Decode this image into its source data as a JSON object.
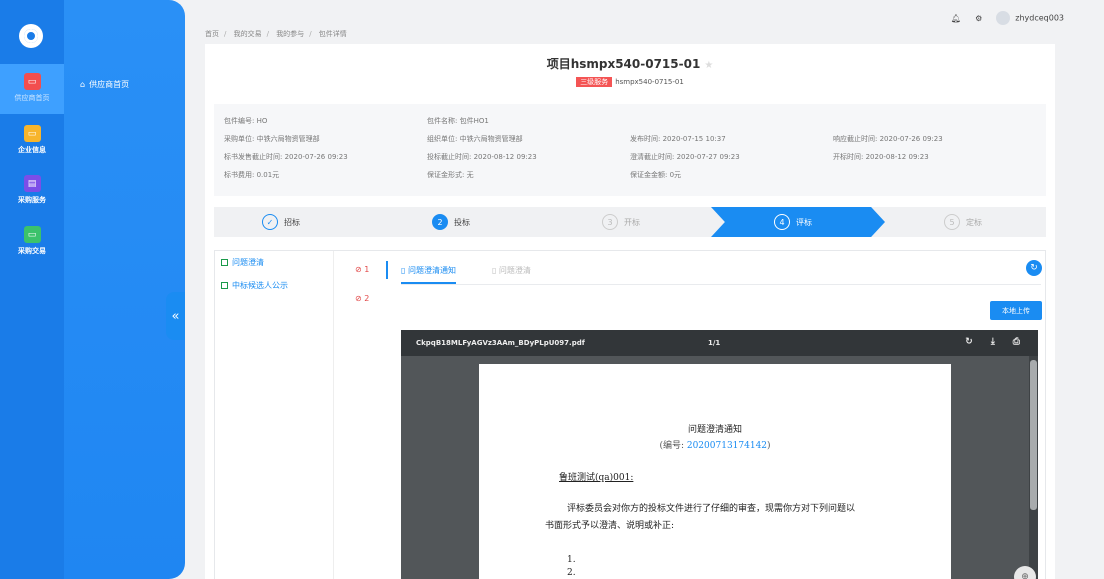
{
  "sidebar": {
    "rail": [
      {
        "label": "供应商首页",
        "color": "#f24e4e"
      },
      {
        "label": "企业信息",
        "color": "#f7b52c"
      },
      {
        "label": "采购服务",
        "color": "#7b4ee8"
      },
      {
        "label": "采购交易",
        "color": "#3bc26b"
      }
    ],
    "sub_item": "供应商首页"
  },
  "breadcrumb": [
    "首页",
    "我的交易",
    "我的参与",
    "包件详情"
  ],
  "topbar": {
    "username": "zhydceq003"
  },
  "project": {
    "title": "项目hsmpx540-0715-01",
    "tag": "三级服务",
    "code": "hsmpx540-0715-01"
  },
  "info": {
    "row1": [
      "包件编号: HO",
      "包件名称: 包件HO1"
    ],
    "row2": [
      "采购单位: 中铁六局物资管理部",
      "组织单位: 中铁六局物资管理部",
      "发布时间: 2020-07-15 10:37",
      "响应截止时间: 2020-07-26 09:23"
    ],
    "row3": [
      "标书发售截止时间: 2020-07-26 09:23",
      "投标截止时间: 2020-08-12 09:23",
      "澄清截止时间: 2020-07-27 09:23",
      "开标时间: 2020-08-12 09:23"
    ],
    "row4": [
      "标书费用: 0.01元",
      "保证金形式: 无",
      "保证金金额: 0元"
    ]
  },
  "steps": [
    {
      "num": "✓",
      "label": "招标"
    },
    {
      "num": "2",
      "label": "投标"
    },
    {
      "num": "3",
      "label": "开标"
    },
    {
      "num": "4",
      "label": "评标"
    },
    {
      "num": "5",
      "label": "定标"
    }
  ],
  "tree": [
    "问题澄清",
    "中标候选人公示"
  ],
  "badges": [
    "1",
    "2"
  ],
  "tabs": {
    "active": "问题澄清通知",
    "inactive": "问题澄清"
  },
  "upload_label": "本地上传",
  "pdf": {
    "filename": "CkpqB18MLFyAGVz3AAm_BDyPLpU097.pdf",
    "page": "1/1",
    "doc_title": "问题澄清通知",
    "doc_no_prefix": "(编号: ",
    "doc_no": "20200713174142",
    "doc_no_suffix": ")",
    "addressee": "鲁班测试(qa)001:",
    "body_line1": "评标委员会对你方的投标文件进行了仔细的审查，现需你方对下列问题以",
    "body_line2": "书面形式予以澄清、说明或补正:",
    "list": [
      "1.",
      "2."
    ]
  }
}
